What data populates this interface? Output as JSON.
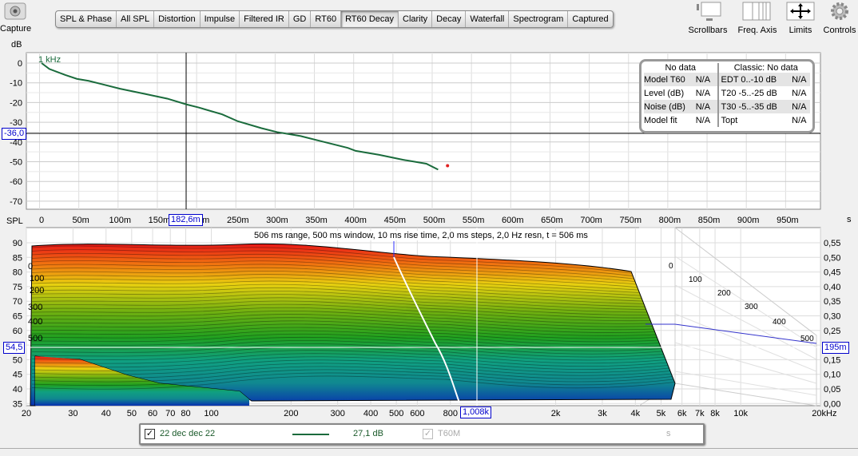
{
  "toolbar": {
    "capture_label": "Capture",
    "tabs": [
      "SPL & Phase",
      "All SPL",
      "Distortion",
      "Impulse",
      "Filtered IR",
      "GD",
      "RT60",
      "RT60 Decay",
      "Clarity",
      "Decay",
      "Waterfall",
      "Spectrogram",
      "Captured"
    ],
    "active_tab": "RT60 Decay",
    "right_tools": [
      {
        "label": "Scrollbars",
        "icon": "scrollbars-icon"
      },
      {
        "label": "Freq. Axis",
        "icon": "freq-axis-icon"
      },
      {
        "label": "Limits",
        "icon": "limits-icon"
      },
      {
        "label": "Controls",
        "icon": "gear-icon"
      }
    ]
  },
  "decay_plot": {
    "y_unit": "dB",
    "x_unit": "s",
    "curve_label": "1 kHz",
    "y_ticks": [
      "0",
      "-10",
      "-20",
      "-30",
      "-40",
      "-50",
      "-60",
      "-70"
    ],
    "x_ticks": [
      "0",
      "50m",
      "100m",
      "150m",
      "200m",
      "250m",
      "300m",
      "350m",
      "400m",
      "450m",
      "500m",
      "550m",
      "600m",
      "650m",
      "700m",
      "750m",
      "800m",
      "850m",
      "900m",
      "950m"
    ],
    "cursor_y": "-36,0",
    "cursor_x": "182,6m",
    "curve_color": "#1a6b3c",
    "curve": [
      [
        0,
        0
      ],
      [
        10,
        -3
      ],
      [
        30,
        -6
      ],
      [
        45,
        -8
      ],
      [
        60,
        -9
      ],
      [
        100,
        -13
      ],
      [
        130,
        -15.5
      ],
      [
        160,
        -18
      ],
      [
        185,
        -21
      ],
      [
        200,
        -22.5
      ],
      [
        230,
        -26
      ],
      [
        250,
        -29.5
      ],
      [
        280,
        -33
      ],
      [
        300,
        -35
      ],
      [
        330,
        -37
      ],
      [
        360,
        -40
      ],
      [
        390,
        -43
      ],
      [
        400,
        -44.5
      ],
      [
        430,
        -46.5
      ],
      [
        460,
        -49
      ],
      [
        490,
        -51
      ],
      [
        505,
        -54
      ]
    ],
    "marker": [
      517,
      -52
    ],
    "info_table": {
      "left_header": "No data",
      "right_header": "Classic: No data",
      "rows": [
        {
          "k1": "Model T60",
          "v1": "N/A",
          "k2": "EDT  0..-10 dB",
          "v2": "N/A"
        },
        {
          "k1": "Level (dB)",
          "v1": "N/A",
          "k2": "T20 -5..-25 dB",
          "v2": "N/A"
        },
        {
          "k1": "Noise (dB)",
          "v1": "N/A",
          "k2": "T30 -5..-35 dB",
          "v2": "N/A"
        },
        {
          "k1": "Model fit",
          "v1": "N/A",
          "k2": "Topt",
          "v2": "N/A"
        }
      ]
    }
  },
  "waterfall": {
    "y_unit": "SPL",
    "x_unit": "kHz",
    "right_unit": "s",
    "info_text": "506 ms range, 500 ms window, 10 ms rise time, 2,0 ms steps,  2,0 Hz resn, t = 506 ms",
    "y_ticks": [
      "90",
      "85",
      "80",
      "75",
      "70",
      "65",
      "60",
      "55",
      "50",
      "45",
      "40",
      "35"
    ],
    "right_ticks": [
      "0,55",
      "0,50",
      "0,45",
      "0,40",
      "0,35",
      "0,30",
      "0,25",
      "0,20",
      "0,15",
      "0,10",
      "0,05",
      "0,00"
    ],
    "x_ticks": [
      [
        "20",
        20
      ],
      [
        "30",
        30
      ],
      [
        "40",
        40
      ],
      [
        "50",
        50
      ],
      [
        "60",
        60
      ],
      [
        "70",
        70
      ],
      [
        "80",
        80
      ],
      [
        "100",
        100
      ],
      [
        "200",
        200
      ],
      [
        "300",
        300
      ],
      [
        "400",
        400
      ],
      [
        "500",
        500
      ],
      [
        "600",
        600
      ],
      [
        "800",
        800
      ],
      [
        "2k",
        2000
      ],
      [
        "3k",
        3000
      ],
      [
        "4k",
        4000
      ],
      [
        "5k",
        5000
      ],
      [
        "6k",
        6000
      ],
      [
        "7k",
        7000
      ],
      [
        "8k",
        8000
      ],
      [
        "10k",
        10000
      ],
      [
        "20kHz",
        20000
      ]
    ],
    "time_slice_labels": [
      "0",
      "100",
      "200",
      "300",
      "400",
      "500"
    ],
    "cursor_spl": "54,5",
    "cursor_freq": "1,008k",
    "cursor_time": "195m"
  },
  "legend": {
    "checked": true,
    "name": "22 dec dec 22",
    "value": "27,1 dB",
    "t60m_checked": true,
    "t60m_label": "T60M",
    "t60m_unit": "s",
    "line_color": "#1a6b3c"
  }
}
